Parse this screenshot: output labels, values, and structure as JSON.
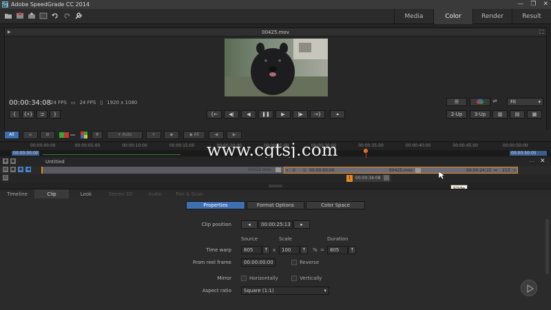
{
  "window": {
    "title": "Adobe SpeedGrade CC 2014",
    "app_icon": "Sg",
    "min": "—",
    "max": "❐",
    "close": "✕"
  },
  "toolbar": {
    "icons": [
      "folder-icon",
      "save-red-icon",
      "export-icon",
      "render-icon",
      "undo-icon",
      "redo-icon",
      "wrench-icon"
    ],
    "tabs": [
      {
        "label": "Media",
        "active": false
      },
      {
        "label": "Color",
        "active": true
      },
      {
        "label": "Render",
        "active": false
      },
      {
        "label": "Result",
        "active": false
      }
    ]
  },
  "viewer": {
    "filename": "00425.mov",
    "timecode": "00:00:34:08",
    "fps1": "24 FPS",
    "fps2": "24 FPS",
    "resolution": "1920 x 1080",
    "zoom_options_selected": "Fit",
    "btn_2up": "2-Up",
    "btn_3up": "3-Up"
  },
  "timeline": {
    "all_label": "All",
    "auto_label": "Auto",
    "all2_label": "All",
    "ruler_start": "00:00:00:00",
    "ruler_end": "00:00:50:05",
    "ticks": [
      "00:00:00:00",
      "00:00:05:00",
      "00:00:10:00",
      "00:00:15:00",
      "00:00:20:00",
      "00:00:25:00",
      "00:00:30:00",
      "00:00:35:00",
      "00:00:40:00",
      "00:00:45:00",
      "00:00:50:00"
    ],
    "track_name": "Untitled",
    "clip1_name": "00422.mov",
    "clip2_name": "00425.mov",
    "clip2_in": "00:00:00:00",
    "clip2_out": "00:00:24:15",
    "clip2_left_val": "0",
    "clip2_right_val": "213",
    "playhead_tc": "00:00:34:08",
    "playhead_marker": "1",
    "tooltip": "Slide",
    "watermark": "www.cgtsj.com"
  },
  "clip_tabs": [
    {
      "label": "Timeline",
      "state": "normal"
    },
    {
      "label": "Clip",
      "state": "active"
    },
    {
      "label": "Look",
      "state": "normal"
    },
    {
      "label": "Stereo 3D",
      "state": "dim"
    },
    {
      "label": "Audio",
      "state": "dim"
    },
    {
      "label": "Pan & Scan",
      "state": "dim"
    }
  ],
  "panel": {
    "segments": [
      {
        "label": "Properties",
        "active": true
      },
      {
        "label": "Format Options",
        "active": false
      },
      {
        "label": "Color Space",
        "active": false
      }
    ],
    "clip_position_label": "Clip position",
    "clip_position_value": "00:00:25:13",
    "source_hdr": "Source",
    "scale_hdr": "Scale",
    "duration_hdr": "Duration",
    "time_warp_label": "Time warp",
    "source_value": "805",
    "x_sym": "x",
    "scale_value": "100",
    "pct_sym": "%",
    "eq_sym": "=",
    "duration_value": "805",
    "from_reel_label": "From reel frame",
    "from_reel_value": "00:00:00:00",
    "reverse_label": "Reverse",
    "mirror_label": "Mirror",
    "horiz_label": "Horizontally",
    "vert_label": "Vertically",
    "aspect_label": "Aspect ratio",
    "aspect_value": "Square (1:1)"
  }
}
